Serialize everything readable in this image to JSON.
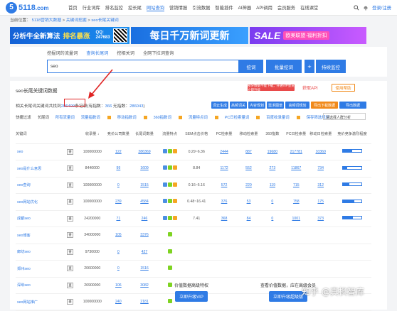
{
  "header": {
    "logo_mark": "5",
    "logo_text": "5118",
    "logo_suffix": ".com",
    "nav": [
      "首页",
      "行业词库",
      "排名监控",
      "挖长尾",
      "网站查询",
      "营销情报",
      "引流数据",
      "智能插件",
      "AI神器",
      "API调用",
      "会员服务",
      "在线课堂"
    ],
    "active_nav_index": 4,
    "login": "登录/注册"
  },
  "breadcrumb": {
    "items": [
      "当前位置：",
      "5118营销大数据",
      ">",
      "关键词挖掘",
      ">",
      "seo长尾关键词"
    ]
  },
  "banners": {
    "b1_title": "分析牛全新算法",
    "b1_highlight": "排名暴涨",
    "b1_qq_label": "QQ:",
    "b1_qq": "247683",
    "b2_text": "每日千万新词更新",
    "b3_sale": "SALE",
    "b3_tag": "欧美联盟·福利折扣"
  },
  "search": {
    "tabs": [
      "挖掘词的流量词",
      "查询长尾词",
      "挖相关词",
      "全网下拉词查询"
    ],
    "selected_tab": 1,
    "value": "seo",
    "dig_button": "挖词",
    "batch_button": "批量挖词",
    "monitor_plus": "+",
    "monitor_button": "持续监控"
  },
  "panel": {
    "title": "seo长尾关键词数据",
    "warning": "部分数据不能下载，开通VIP会员 立即升级",
    "api": "获取API",
    "usage": "使用帮助",
    "stats_prefix": "相关长尾词关键词共找到",
    "total": "286409",
    "stats_mid": "条记录(有指数：",
    "with_index": "366",
    "stats_mid2": " 无指数：",
    "no_index": "286043",
    "stats_suffix": ")"
  },
  "tools": [
    "词云生成",
    "高频词关",
    "内容规划",
    "需求图谱",
    "高频词规划",
    "导出下载数据",
    "导出数据"
  ],
  "filters": {
    "label": "快捷过滤",
    "items": [
      "长尾词",
      "所有流量词",
      "流量指数词",
      "移动指数词",
      "360指数词",
      "流量特点词",
      "PC日检索量词",
      "百度收录量词",
      "保存筛选规则"
    ],
    "select": "请选择人群分析"
  },
  "table": {
    "headers": [
      "关键词",
      "",
      "收录量 ↓",
      "竞价公司数量",
      "长尾词数量",
      "流量特点",
      "SEM点击价格",
      "PC检索量",
      "移动检索量",
      "360指数",
      "PC日检索量",
      "移动日检索量",
      "竞价竞争激烈程度"
    ],
    "query_label": "查",
    "rows": [
      {
        "kw": "seo",
        "n1": "100000000",
        "n2": "122",
        "n3": "286369",
        "sem": "0.29~6.36",
        "a": "2444",
        "b": "887",
        "c": "19680",
        "d": "217781",
        "e": "10360",
        "bar": 0.5
      },
      {
        "kw": "seo是什么意思",
        "n1": "8440000",
        "n2": "99",
        "n3": "1609",
        "sem": "8.84",
        "a": "1172",
        "b": "552",
        "c": "273",
        "d": "11867",
        "e": "734",
        "bar": 0.25
      },
      {
        "kw": "seo查询",
        "n1": "100000000",
        "n2": "0",
        "n3": "1515",
        "sem": "0.16~5.16",
        "a": "572",
        "b": "220",
        "c": "119",
        "d": "715",
        "e": "312",
        "bar": 0.35
      },
      {
        "kw": "seo网站优化",
        "n1": "100000000",
        "n2": "239",
        "n3": "4584",
        "sem": "0.48~16.41",
        "a": "376",
        "b": "53",
        "c": "0",
        "d": "758",
        "e": "175",
        "bar": 0.6
      },
      {
        "kw": "成都seo",
        "n1": "24200000",
        "n2": "71",
        "n3": "246",
        "sem": "7.41",
        "a": "368",
        "b": "84",
        "c": "0",
        "d": "1001",
        "e": "373",
        "bar": 0.55
      },
      {
        "kw": "seo博客",
        "n1": "34000000",
        "n2": "105",
        "n3": "3376",
        "sem": "",
        "a": "",
        "b": "",
        "c": "",
        "d": "",
        "e": "",
        "bar": 0
      },
      {
        "kw": "廊坊seo",
        "n1": "9730000",
        "n2": "0",
        "n3": "427",
        "sem": "",
        "a": "",
        "b": "",
        "c": "",
        "d": "",
        "e": "",
        "bar": 0
      },
      {
        "kw": "郑州seo",
        "n1": "20600000",
        "n2": "0",
        "n3": "1516",
        "sem": "",
        "a": "",
        "b": "",
        "c": "",
        "d": "",
        "e": "",
        "bar": 0
      },
      {
        "kw": "深圳seo",
        "n1": "26900000",
        "n2": "106",
        "n3": "3082",
        "sem": "",
        "a": "",
        "b": "",
        "c": "",
        "d": "",
        "e": "",
        "bar": 0
      },
      {
        "kw": "seo网站推广",
        "n1": "100000000",
        "n2": "240",
        "n3": "2181",
        "sem": "",
        "a": "",
        "b": "",
        "c": "",
        "d": "",
        "e": "",
        "bar": 0
      }
    ]
  },
  "overlays": {
    "left_text": "价值数据高级特权",
    "left_button": "立即升级VIP",
    "right_text": "查看价值数据，应在高级会员",
    "right_button": "立即升级超级版"
  },
  "watermark": "知乎 @真枫智库",
  "colors": {
    "brand": "#2f7be5",
    "warn": "#e94a4a",
    "orange": "#f18a1b"
  }
}
